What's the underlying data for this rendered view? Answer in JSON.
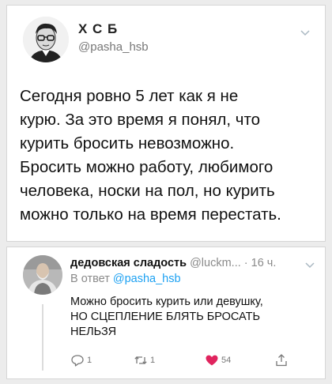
{
  "tweet1": {
    "display_name": "Х С Б",
    "handle": "@pasha_hsb",
    "lines": [
      "Сегодня ровно 5 лет как я не",
      "курю. За это время я понял, что",
      "курить бросить невозможно.",
      "Бросить можно работу, любимого",
      "человека, носки на пол, но курить",
      "можно только на время перестать."
    ]
  },
  "tweet2": {
    "display_name": "дедовская сладость",
    "handle_time": " @luckm... · 16 ч.",
    "reply_prefix": "В ответ ",
    "reply_handle": "@pasha_hsb",
    "lines": [
      "Можно бросить курить или девушку,",
      "НО СЦЕПЛЕНИЕ БЛЯТЬ БРОСАТЬ",
      "НЕЛЬЗЯ"
    ],
    "reply_count": "1",
    "retweet_count": "1",
    "like_count": "54",
    "icons": {
      "reply": "reply-icon",
      "retweet": "retweet-icon",
      "like": "heart-icon",
      "share": "share-icon"
    },
    "colors": {
      "like": "#e0245e",
      "link": "#1da1f2"
    }
  }
}
